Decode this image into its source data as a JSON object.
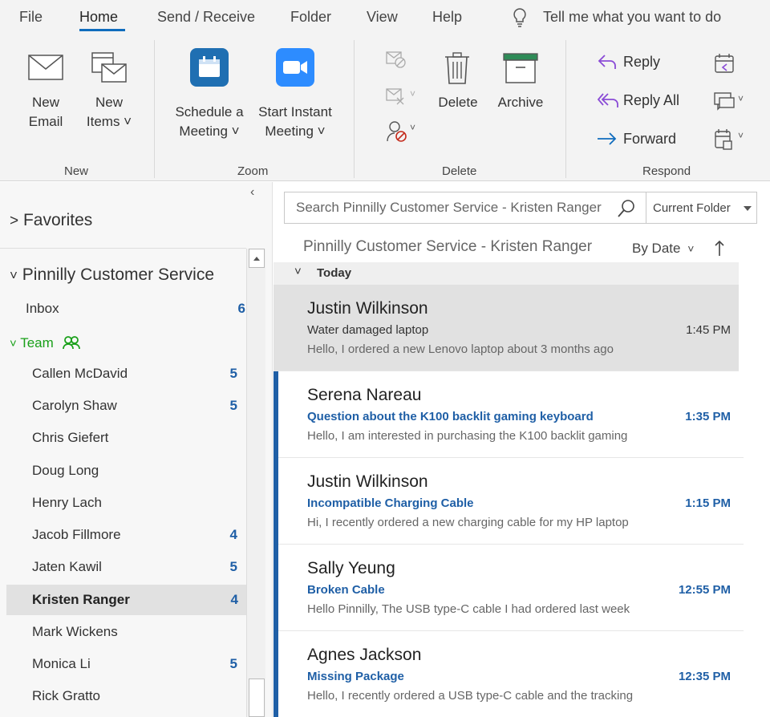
{
  "tabs": [
    "File",
    "Home",
    "Send / Receive",
    "Folder",
    "View",
    "Help"
  ],
  "tell_me": "Tell me what you want to do",
  "ribbon": {
    "new_email": [
      "New",
      "Email"
    ],
    "new_items": [
      "New",
      "Items"
    ],
    "schedule_meeting": [
      "Schedule a",
      "Meeting"
    ],
    "instant_meeting": [
      "Start Instant",
      "Meeting"
    ],
    "delete": "Delete",
    "archive": "Archive",
    "reply": "Reply",
    "reply_all": "Reply All",
    "forward": "Forward",
    "groups": {
      "new": "New",
      "zoom": "Zoom",
      "delete": "Delete",
      "respond": "Respond"
    }
  },
  "folders": {
    "favorites": "Favorites",
    "account": "Pinnilly Customer Service",
    "inbox": {
      "name": "Inbox",
      "count": "6"
    },
    "team": "Team",
    "members": [
      {
        "name": "Callen McDavid",
        "count": "5"
      },
      {
        "name": "Carolyn Shaw",
        "count": "5"
      },
      {
        "name": "Chris Giefert",
        "count": ""
      },
      {
        "name": "Doug Long",
        "count": ""
      },
      {
        "name": "Henry Lach",
        "count": ""
      },
      {
        "name": "Jacob Fillmore",
        "count": "4"
      },
      {
        "name": "Jaten Kawil",
        "count": "5"
      },
      {
        "name": "Kristen Ranger",
        "count": "4"
      },
      {
        "name": "Mark Wickens",
        "count": ""
      },
      {
        "name": "Monica Li",
        "count": "5"
      },
      {
        "name": "Rick Gratto",
        "count": ""
      }
    ]
  },
  "search": {
    "placeholder": "Search Pinnilly Customer Service - Kristen Ranger",
    "scope": "Current Folder"
  },
  "list": {
    "title": "Pinnilly Customer Service - Kristen Ranger",
    "sort": "By Date",
    "group": "Today",
    "messages": [
      {
        "sender": "Justin Wilkinson",
        "subject": "Water damaged laptop",
        "preview": "Hello,  I ordered a new Lenovo laptop about 3 months ago",
        "time": "1:45 PM"
      },
      {
        "sender": "Serena Nareau",
        "subject": "Question about the K100 backlit gaming keyboard",
        "preview": "Hello,  I am interested in purchasing the K100 backlit gaming",
        "time": "1:35 PM"
      },
      {
        "sender": "Justin Wilkinson",
        "subject": "Incompatible Charging Cable",
        "preview": "Hi,  I recently ordered a new charging cable for my HP laptop",
        "time": "1:15 PM"
      },
      {
        "sender": "Sally Yeung",
        "subject": "Broken Cable",
        "preview": "Hello Pinnilly,  The USB type-C cable I had ordered last week",
        "time": "12:55 PM"
      },
      {
        "sender": "Agnes Jackson",
        "subject": "Missing Package",
        "preview": "Hello,  I recently ordered a USB type-C cable and the tracking",
        "time": "12:35 PM"
      }
    ]
  },
  "colors": {
    "accent": "#0f6cbd",
    "unread": "#1f5fa6",
    "team_green": "#1aa01a",
    "zoom_blue": "#2d8cff",
    "meeting_blue": "#1f6fb2"
  }
}
